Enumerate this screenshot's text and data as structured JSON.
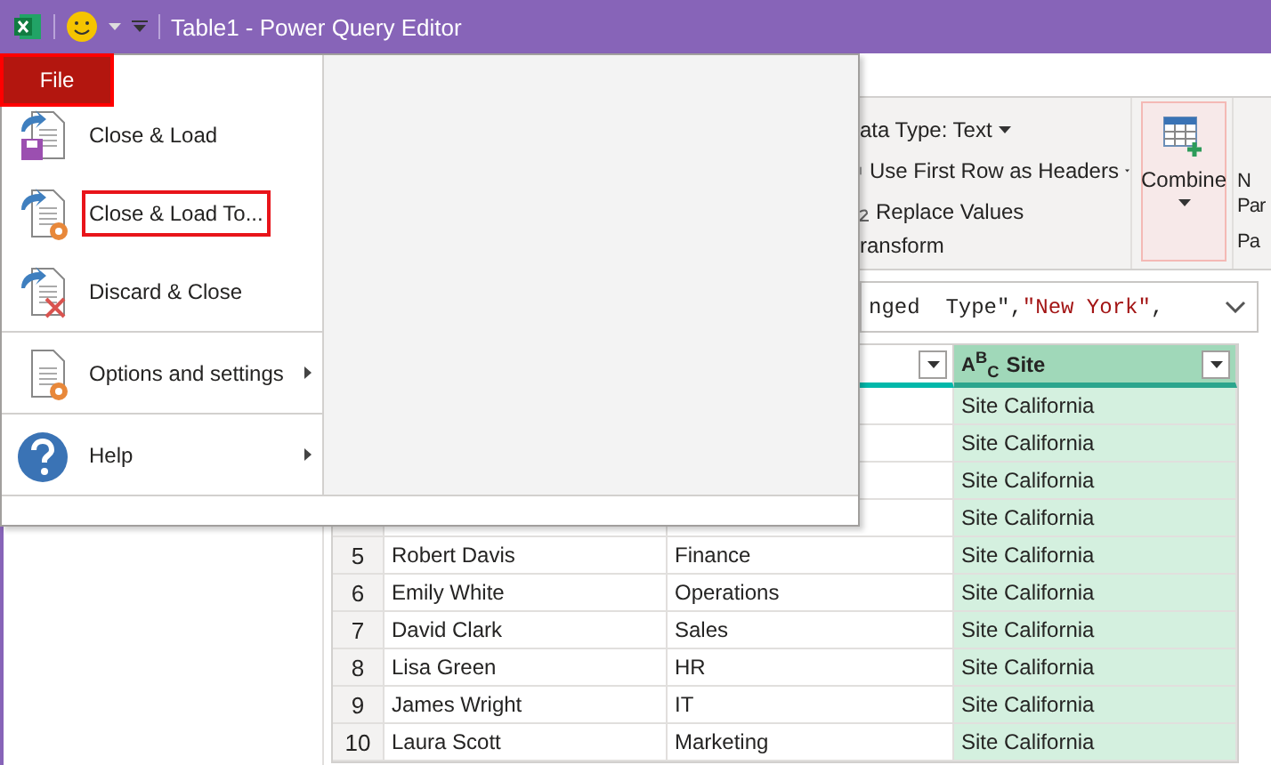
{
  "window": {
    "title": "Table1 - Power Query Editor"
  },
  "file_tab": {
    "label": "File",
    "highlighted": true
  },
  "file_menu": {
    "items": [
      {
        "kind": "load",
        "label": "Close & Load",
        "highlighted": false,
        "has_submenu": false
      },
      {
        "kind": "load_to",
        "label": "Close & Load To...",
        "highlighted": true,
        "has_submenu": false
      },
      {
        "kind": "discard",
        "label": "Discard & Close",
        "highlighted": false,
        "has_submenu": false
      },
      {
        "kind": "options",
        "label": "Options and settings",
        "highlighted": false,
        "has_submenu": true
      },
      {
        "kind": "help",
        "label": "Help",
        "highlighted": false,
        "has_submenu": true
      }
    ]
  },
  "ribbon": {
    "transform": {
      "items": [
        {
          "kind": "plain",
          "label": "ata Type: Text",
          "dropdown": true
        },
        {
          "kind": "headers",
          "label": "Use First Row as Headers",
          "dropdown": true
        },
        {
          "kind": "replace",
          "label": "Replace Values",
          "dropdown": false
        }
      ],
      "group_label": "ransform"
    },
    "combine": {
      "label": "Combine",
      "highlighted": true
    },
    "cut_button": {
      "lines": [
        "N",
        "Par"
      ],
      "group_label": "Pa"
    }
  },
  "formula": {
    "parts": [
      {
        "kind": "plain",
        "text": "nged  Type\","
      },
      {
        "kind": "string",
        "text": "\"New York\""
      },
      {
        "kind": "plain",
        "text": ","
      }
    ]
  },
  "table": {
    "columns": [
      {
        "selected": false
      },
      {
        "selected": false
      },
      {
        "type_icon": "A$^{B}$$_{C}$",
        "label": "Site",
        "selected": true
      }
    ],
    "rows": [
      {
        "index": "",
        "cells": [
          "",
          "",
          "Site California"
        ]
      },
      {
        "index": "",
        "cells": [
          "",
          "",
          "Site California"
        ]
      },
      {
        "index": "",
        "cells": [
          "",
          "",
          "Site California"
        ]
      },
      {
        "index": "",
        "cells": [
          "",
          "",
          "Site California"
        ]
      },
      {
        "index": "5",
        "cells": [
          "Robert Davis",
          "Finance",
          "Site California"
        ]
      },
      {
        "index": "6",
        "cells": [
          "Emily White",
          "Operations",
          "Site California"
        ]
      },
      {
        "index": "7",
        "cells": [
          "David Clark",
          "Sales",
          "Site California"
        ]
      },
      {
        "index": "8",
        "cells": [
          "Lisa Green",
          "HR",
          "Site California"
        ]
      },
      {
        "index": "9",
        "cells": [
          "James Wright",
          "IT",
          "Site California"
        ]
      },
      {
        "index": "10",
        "cells": [
          "Laura Scott",
          "Marketing",
          "Site California"
        ]
      }
    ]
  }
}
